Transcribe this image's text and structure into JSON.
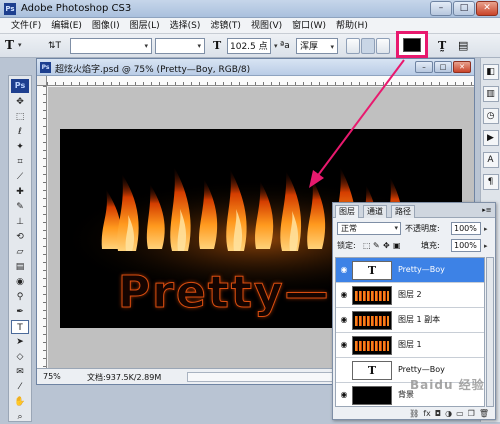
{
  "app": {
    "title": "Adobe Photoshop CS3",
    "logo": "Ps",
    "window_buttons": [
      "–",
      "□",
      "✕"
    ]
  },
  "menu": [
    "文件(F)",
    "编辑(E)",
    "图像(I)",
    "图层(L)",
    "选择(S)",
    "滤镜(T)",
    "视图(V)",
    "窗口(W)",
    "帮助(H)"
  ],
  "options_bar": {
    "tool_glyph": "T",
    "orient_glyph": "⇅T",
    "font_size": "102.5 点",
    "aa_label": "ªa",
    "aa_mode": "浑厚",
    "text_color_hex": "#000000"
  },
  "document": {
    "title": "超炫火焰字.psd @ 75% (Pretty—Boy, RGB/8)",
    "zoom": "75%",
    "info": "文档:937.5K/2.89M",
    "canvas_text": "Pretty—B",
    "arrow_color": "#e8196e"
  },
  "layers_panel": {
    "tabs": [
      "图层",
      "通道",
      "路径"
    ],
    "blend_mode": "正常",
    "opacity_label": "不透明度:",
    "opacity_value": "100%",
    "lock_label": "锁定:",
    "fill_label": "填充:",
    "fill_value": "100%",
    "layers": [
      {
        "name": "Pretty—Boy",
        "thumb": "T",
        "kind": "text"
      },
      {
        "name": "图层 2",
        "thumb": "",
        "kind": "flame"
      },
      {
        "name": "图层 1 副本",
        "thumb": "",
        "kind": "flame"
      },
      {
        "name": "图层 1",
        "thumb": "",
        "kind": "flame"
      },
      {
        "name": "Pretty—Boy",
        "thumb": "T",
        "kind": "text"
      },
      {
        "name": "背景",
        "thumb": "",
        "kind": "black"
      }
    ]
  },
  "watermark": "Baidu 经验"
}
